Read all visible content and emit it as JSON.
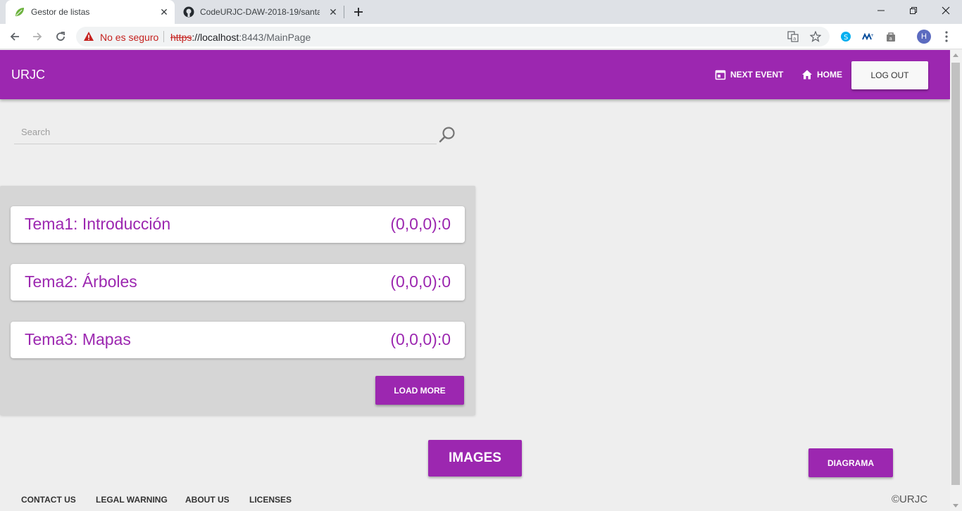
{
  "browser": {
    "tabs": [
      {
        "title": "Gestor de listas"
      },
      {
        "title": "CodeURJC-DAW-2018-19/santat"
      }
    ],
    "security_label": "No es seguro",
    "url_scheme": "https",
    "url_host": "://localhost",
    "url_rest": ":8443/MainPage",
    "profile_initial": "H"
  },
  "app": {
    "brand": "URJC",
    "nav": {
      "next_event": "NEXT EVENT",
      "home": "HOME",
      "logout": "LOG OUT"
    },
    "search": {
      "placeholder": "Search",
      "value": ""
    },
    "topics": [
      {
        "title": "Tema1: Introducción",
        "score": "(0,0,0):0"
      },
      {
        "title": "Tema2: Árboles",
        "score": "(0,0,0):0"
      },
      {
        "title": "Tema3: Mapas",
        "score": "(0,0,0):0"
      }
    ],
    "load_more": "LOAD MORE",
    "images": "IMAGES",
    "diagrama": "DIAGRAMA",
    "footer": {
      "contact": "CONTACT US",
      "legal": "LEGAL WARNING",
      "about": "ABOUT US",
      "licenses": "LICENSES",
      "copyright": "©URJC"
    }
  },
  "colors": {
    "primary": "#9c27b0",
    "background": "#eeeeee",
    "panel": "#d6d6d6"
  }
}
